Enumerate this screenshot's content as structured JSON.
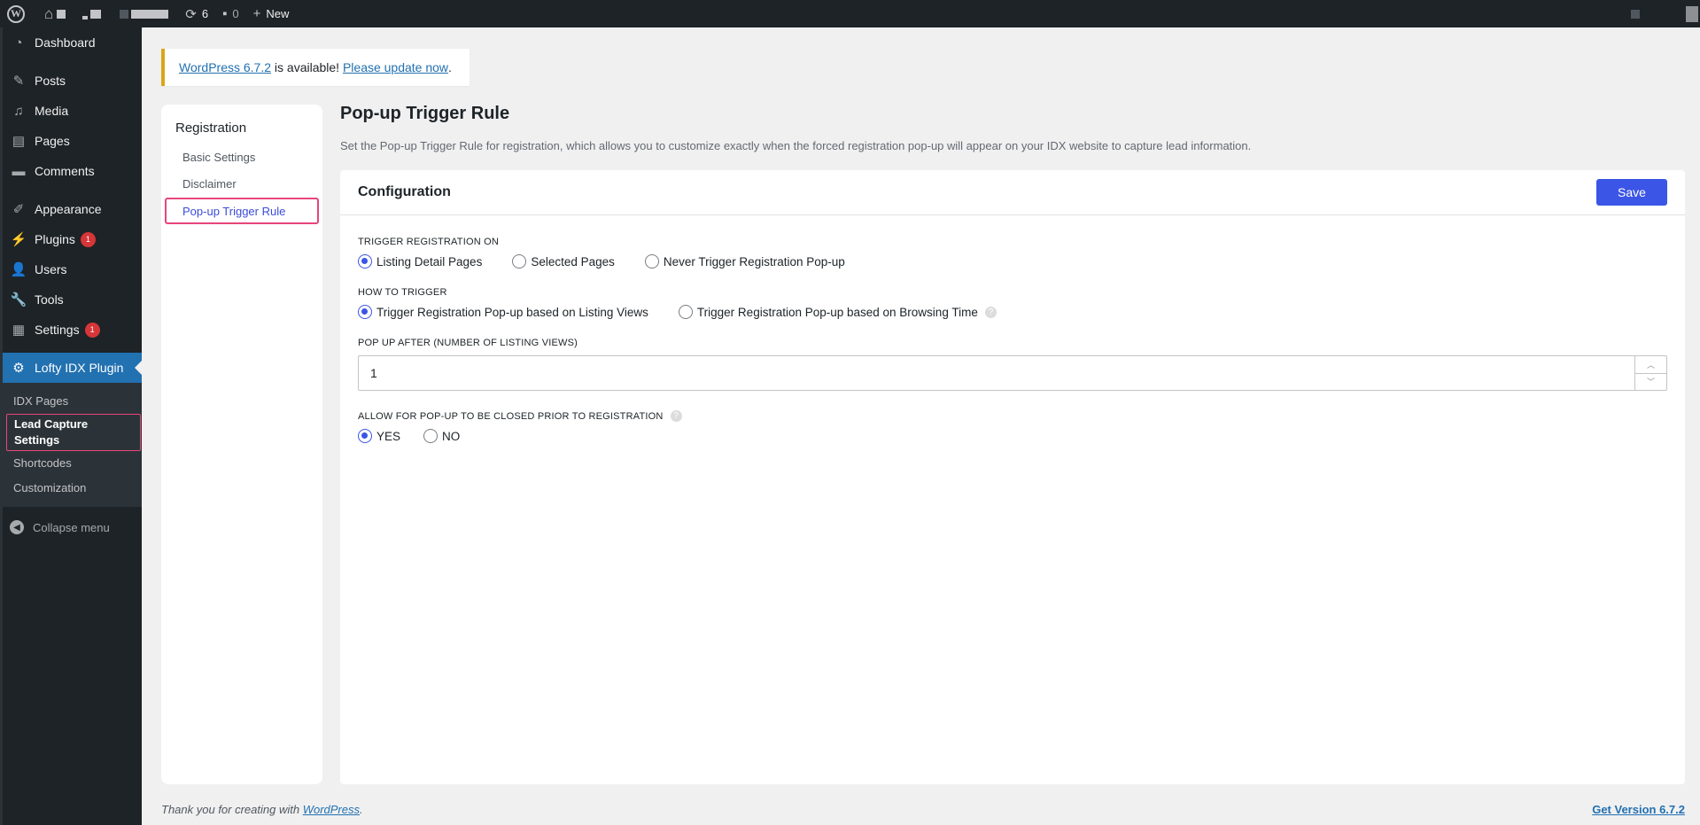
{
  "adminbar": {
    "updates_count": "6",
    "comments_count": "0",
    "new_label": "New"
  },
  "sidebar": {
    "items": [
      {
        "label": "Dashboard",
        "icon": "dashboard-icon"
      },
      {
        "label": "Posts",
        "icon": "pin-icon"
      },
      {
        "label": "Media",
        "icon": "media-icon"
      },
      {
        "label": "Pages",
        "icon": "pages-icon"
      },
      {
        "label": "Comments",
        "icon": "comment-icon"
      },
      {
        "label": "Appearance",
        "icon": "brush-icon"
      },
      {
        "label": "Plugins",
        "icon": "plugin-icon",
        "badge": "1"
      },
      {
        "label": "Users",
        "icon": "user-icon"
      },
      {
        "label": "Tools",
        "icon": "wrench-icon"
      },
      {
        "label": "Settings",
        "icon": "settings-icon",
        "badge": "1"
      },
      {
        "label": "Lofty IDX Plugin",
        "icon": "gear-icon"
      }
    ],
    "submenu": [
      "IDX Pages",
      "Lead Capture Settings",
      "Shortcodes",
      "Customization"
    ],
    "collapse_label": "Collapse menu"
  },
  "notice": {
    "version_link": "WordPress 6.7.2",
    "middle_text": " is available! ",
    "update_link": "Please update now",
    "end": "."
  },
  "settings_nav": {
    "title": "Registration",
    "items": [
      "Basic Settings",
      "Disclaimer",
      "Pop-up Trigger Rule"
    ]
  },
  "main": {
    "title": "Pop-up Trigger Rule",
    "description": "Set the Pop-up Trigger Rule for registration, which allows you to customize exactly when the forced registration pop-up will appear on your IDX website to capture lead information."
  },
  "card": {
    "title": "Configuration",
    "save_label": "Save",
    "trigger_on": {
      "label": "TRIGGER REGISTRATION ON",
      "options": [
        "Listing Detail Pages",
        "Selected Pages",
        "Never Trigger Registration Pop-up"
      ],
      "selected": "Listing Detail Pages"
    },
    "how_to_trigger": {
      "label": "HOW TO TRIGGER",
      "options": [
        "Trigger Registration Pop-up based on Listing Views",
        "Trigger Registration Pop-up based on Browsing Time"
      ],
      "selected": "Trigger Registration Pop-up based on Listing Views"
    },
    "popup_after": {
      "label": "POP UP AFTER (NUMBER OF LISTING VIEWS)",
      "value": "1"
    },
    "allow_close": {
      "label": "ALLOW FOR POP-UP TO BE CLOSED PRIOR TO REGISTRATION",
      "options": [
        "YES",
        "NO"
      ],
      "selected": "YES"
    }
  },
  "footer": {
    "thanks_text": "Thank you for creating with ",
    "thanks_link": "WordPress",
    "thanks_end": ".",
    "version_link": "Get Version 6.7.2"
  },
  "colors": {
    "accent": "#3b55e6",
    "admin_bg": "#1d2327",
    "highlight_border": "#e8457a",
    "current_menu": "#2271b1"
  }
}
